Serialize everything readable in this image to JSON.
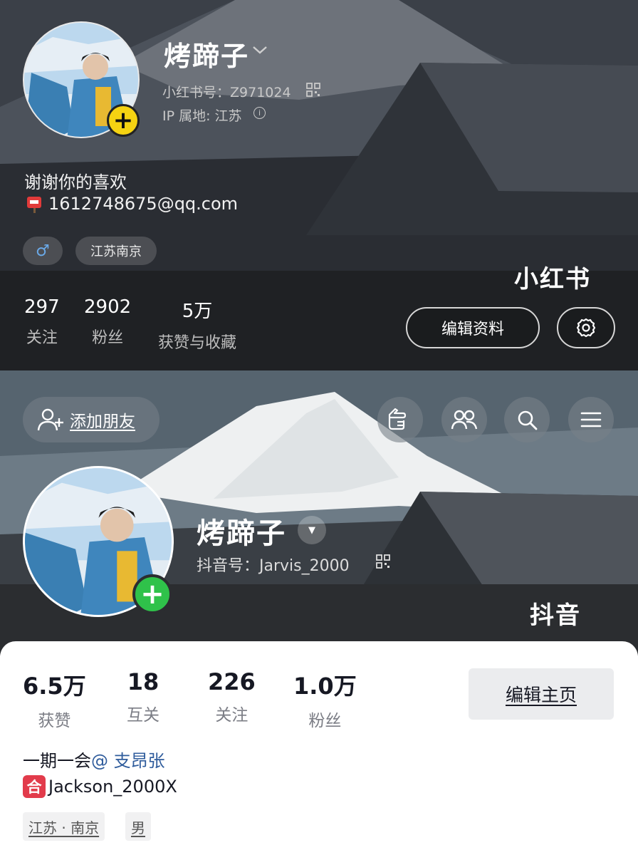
{
  "xiaohongshu": {
    "nickname": "烤蹄子",
    "id_label": "小红书号：Z971024",
    "ip_label": "IP 属地: 江苏",
    "bio_line1": "谢谢你的喜欢",
    "bio_line2": "1612748675@qq.com",
    "tags": {
      "gender_symbol": "♂",
      "location": "江苏南京"
    },
    "brand_caption": "小红书",
    "stats": [
      {
        "value": "297",
        "label": "关注"
      },
      {
        "value": "2902",
        "label": "粉丝"
      },
      {
        "value": "5万",
        "label": "获赞与收藏"
      }
    ],
    "edit_profile_label": "编辑资料",
    "icons": [
      "avatar",
      "add-icon",
      "chevron-down-icon",
      "qrcode-icon",
      "info-icon",
      "mailbox-icon",
      "gear-icon"
    ],
    "colors": {
      "add_badge": "#f5d312",
      "background": "#1f2124"
    }
  },
  "douyin": {
    "add_friend_label": "添加朋友",
    "nickname": "烤蹄子",
    "id_label": "抖音号：Jarvis_2000",
    "brand_caption": "抖音",
    "stats": [
      {
        "value": "6.5万",
        "label": "获赞"
      },
      {
        "value": "18",
        "label": "互关"
      },
      {
        "value": "226",
        "label": "关注"
      },
      {
        "value": "1.0万",
        "label": "粉丝"
      }
    ],
    "edit_home_label": "编辑主页",
    "bio_line1_text": "一期一会",
    "bio_line1_mention": "@ 支昂张",
    "bio_line2_badge": "合",
    "bio_line2_text": "Jackson_2000X",
    "tags": {
      "location": "江苏 · 南京",
      "gender": "男"
    },
    "icons": [
      "add-user-icon",
      "pointing-hand-icon",
      "friends-icon",
      "search-icon",
      "menu-icon",
      "dropdown-triangle-icon",
      "qrcode-icon",
      "add-icon"
    ],
    "colors": {
      "add_badge": "#2fc24a",
      "tag_background": "#f1f1f2",
      "he_badge": "#e23b4b"
    }
  }
}
